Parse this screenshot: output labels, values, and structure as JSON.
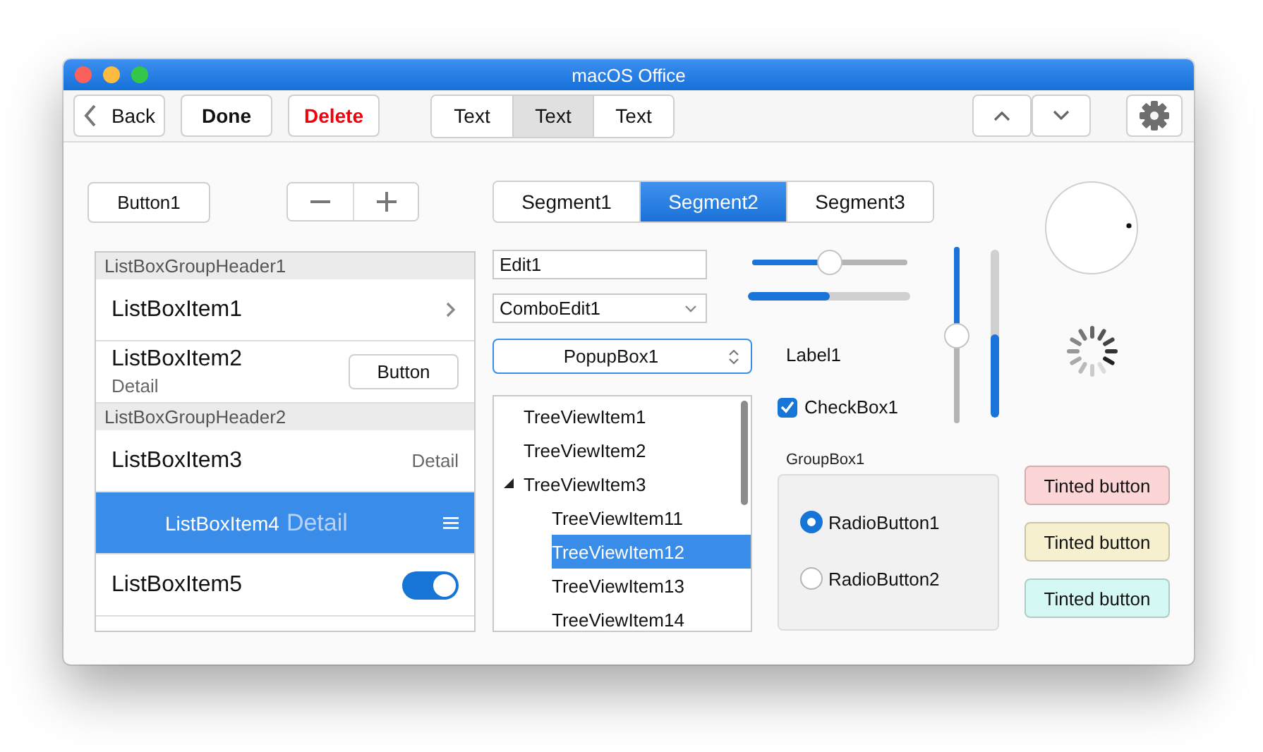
{
  "window": {
    "title": "macOS Office",
    "traffic_lights": [
      {
        "color": "#fc605b"
      },
      {
        "color": "#fdbc40"
      },
      {
        "color": "#34c84a"
      }
    ]
  },
  "toolbar": {
    "buttons": [
      {
        "kind": "back",
        "label": "Back"
      },
      {
        "kind": "default",
        "label": "Done"
      },
      {
        "kind": "destructive",
        "label": "Delete"
      }
    ],
    "segments": [
      {
        "label": "Text",
        "selected": false
      },
      {
        "label": "Text",
        "selected": true
      },
      {
        "label": "Text",
        "selected": false
      }
    ]
  },
  "button1": {
    "label": "Button1"
  },
  "listbox": {
    "items": [
      {
        "kind": "header",
        "text": "ListBoxGroupHeader1"
      },
      {
        "kind": "chevron",
        "text": "ListBoxItem1",
        "selected": false
      },
      {
        "kind": "button",
        "text": "ListBoxItem2",
        "detail": "Detail",
        "button": "Button",
        "selected": false
      },
      {
        "kind": "header",
        "text": "ListBoxGroupHeader2"
      },
      {
        "kind": "detail_right",
        "text": "ListBoxItem3",
        "detail": "Detail",
        "selected": false
      },
      {
        "kind": "inline_detail",
        "text": "ListBoxItem4",
        "detail": "Detail",
        "selected": true
      },
      {
        "kind": "switch",
        "text": "ListBoxItem5",
        "on": true,
        "selected": false
      }
    ]
  },
  "segments": [
    {
      "label": "Segment1",
      "selected": false
    },
    {
      "label": "Segment2",
      "selected": true
    },
    {
      "label": "Segment3",
      "selected": false
    }
  ],
  "edit": {
    "value": "Edit1"
  },
  "combo_edit": {
    "value": "ComboEdit1"
  },
  "popup_box": {
    "value": "PopupBox1"
  },
  "tree": {
    "items": [
      {
        "text": "TreeViewItem1",
        "selected": false
      },
      {
        "text": "TreeViewItem2",
        "selected": false
      },
      {
        "text": "TreeViewItem3",
        "selected": false,
        "expanded": true,
        "children": [
          {
            "text": "TreeViewItem11",
            "selected": false
          },
          {
            "text": "TreeViewItem12",
            "selected": true
          },
          {
            "text": "TreeViewItem13",
            "selected": false
          },
          {
            "text": "TreeViewItem14",
            "selected": false
          }
        ]
      }
    ]
  },
  "slider": {
    "level": 0.5
  },
  "progress": {
    "level": 0.5
  },
  "label": "Label1",
  "checkbox": {
    "label": "CheckBox1",
    "checked": true
  },
  "vertical_slider": {
    "level": 0.5
  },
  "vertical_progress": {
    "level": 0.5
  },
  "group_box": {
    "title": "GroupBox1",
    "radios": [
      {
        "label": "RadioButton1",
        "selected": true
      },
      {
        "label": "RadioButton2",
        "selected": false
      }
    ]
  },
  "tinted_buttons": [
    {
      "label": "Tinted button",
      "color": "#fcd6d6"
    },
    {
      "label": "Tinted button",
      "color": "#f6f0cf"
    },
    {
      "label": "Tinted button",
      "color": "#d4f8f3"
    }
  ]
}
